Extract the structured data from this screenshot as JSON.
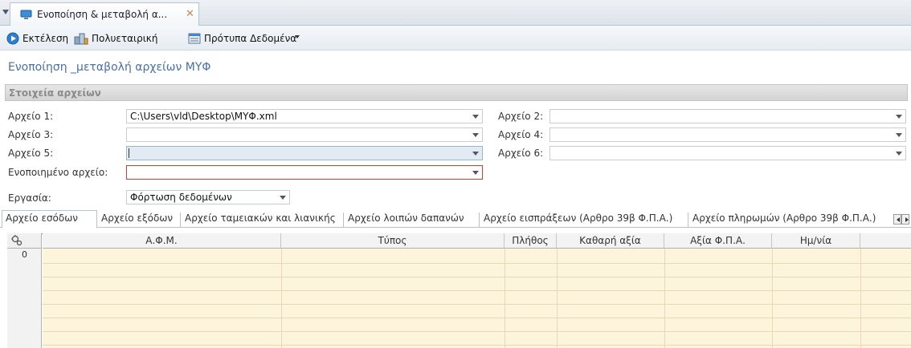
{
  "tab": {
    "title": "Ενοποίηση & μεταβολή α..."
  },
  "toolbar": {
    "execute_label": "Εκτέλεση",
    "multi_company_label": "Πολυεταιρική",
    "template_data_label": "Πρότυπα Δεδομένα"
  },
  "page": {
    "title": "Ενοποίηση _μεταβολή αρχείων ΜΥΦ"
  },
  "section": {
    "title": "Στοιχεία αρχείων"
  },
  "fields": {
    "file1": {
      "label": "Αρχείο 1:",
      "value": "C:\\Users\\vld\\Desktop\\ΜΥΦ.xml"
    },
    "file2": {
      "label": "Αρχείο 2:",
      "value": ""
    },
    "file3": {
      "label": "Αρχείο 3:",
      "value": ""
    },
    "file4": {
      "label": "Αρχείο 4:",
      "value": ""
    },
    "file5": {
      "label": "Αρχείο 5:",
      "value": ""
    },
    "file6": {
      "label": "Αρχείο 6:",
      "value": ""
    },
    "merged": {
      "label": "Ενοποιημένο αρχείο:",
      "value": ""
    },
    "task": {
      "label": "Εργασία:",
      "value": "Φόρτωση δεδομένων"
    }
  },
  "subtabs": [
    {
      "label": "Αρχείο εσόδων",
      "active": true
    },
    {
      "label": "Αρχείο εξόδων"
    },
    {
      "label": "Αρχείο ταμειακών και λιανικής"
    },
    {
      "label": "Αρχείο λοιπών δαπανών"
    },
    {
      "label": "Αρχείο εισπράξεων (Αρθρο 39β Φ.Π.Α.)"
    },
    {
      "label": "Αρχείο πληρωμών (Αρθρο 39β Φ.Π.Α.)"
    }
  ],
  "grid": {
    "columns": [
      "Α.Φ.Μ.",
      "Τύπος",
      "Πλήθος",
      "Καθαρή αξία",
      "Αξία Φ.Π.Α.",
      "Ημ/νία"
    ],
    "first_row_number": "0"
  },
  "colors": {
    "title_blue": "#4a6fa5",
    "grid_row_fill": "#fdf4dc",
    "invalid_border": "#c8402e",
    "focused_fill": "#e2ebf3"
  },
  "icons": [
    "tab-menu-arrow-icon",
    "document-tab-icon",
    "close-icon",
    "execute-icon",
    "multi-company-icon",
    "template-data-icon",
    "grid-settings-icon",
    "dropdown-arrow-icon"
  ]
}
